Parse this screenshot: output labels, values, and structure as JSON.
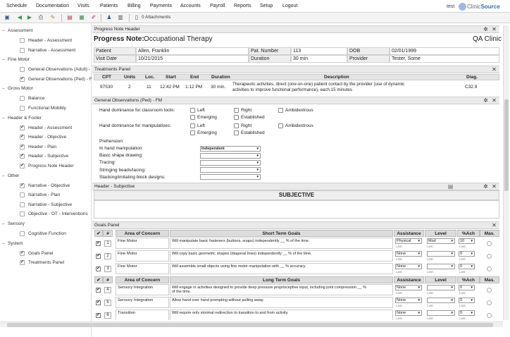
{
  "menu": [
    "Schedule",
    "Documentation",
    "Visits",
    "Patients",
    "Billing",
    "Payments",
    "Accounts",
    "Payroll",
    "Reports",
    "Setup",
    "Logout"
  ],
  "user": "test",
  "logo": {
    "part1": "Clinic",
    "part2": "Source"
  },
  "toolbar": {
    "attachments": "0 Attachments"
  },
  "sidebar": {
    "groups": [
      {
        "label": "Assessment",
        "items": [
          {
            "label": "Header - Assessment",
            "checked": false
          },
          {
            "label": "Narrative - Assessment",
            "checked": false
          }
        ]
      },
      {
        "label": "Fine Motor",
        "items": [
          {
            "label": "General Observations (Adult) -",
            "checked": false
          },
          {
            "label": "General Observations (Ped) - F",
            "checked": true
          }
        ]
      },
      {
        "label": "Gross Motor",
        "items": [
          {
            "label": "Balance",
            "checked": false
          },
          {
            "label": "Functional Mobility",
            "checked": false
          }
        ]
      },
      {
        "label": "Header & Footer",
        "items": [
          {
            "label": "Header - Assessment",
            "checked": true
          },
          {
            "label": "Header - Objective",
            "checked": true
          },
          {
            "label": "Header - Plan",
            "checked": true
          },
          {
            "label": "Header - Subjective",
            "checked": true
          },
          {
            "label": "Progress Note Header",
            "checked": true
          }
        ]
      },
      {
        "label": "Other",
        "items": [
          {
            "label": "Narrative - Objective",
            "checked": true
          },
          {
            "label": "Narrative - Plan",
            "checked": false
          },
          {
            "label": "Narrative - Subjective",
            "checked": false
          },
          {
            "label": "Objective - OT - Interventions",
            "checked": false
          }
        ]
      },
      {
        "label": "Sensory",
        "items": [
          {
            "label": "Cognitive Function",
            "checked": false
          }
        ]
      },
      {
        "label": "System",
        "items": [
          {
            "label": "Goals Panel",
            "checked": true
          },
          {
            "label": "Treatments Panel",
            "checked": true
          }
        ]
      }
    ]
  },
  "progress_header": {
    "panel_title": "Progress Note Header",
    "title_label": "Progress Note:",
    "title_value": "Occupational Therapy",
    "clinic": "QA Clinic",
    "patient_label": "Patient",
    "patient": "Allen, Franklin",
    "patnum_label": "Pat. Number",
    "patnum": "113",
    "dob_label": "DOB",
    "dob": "02/01/1999",
    "visitdate_label": "Visit Date",
    "visitdate": "10/21/2015",
    "duration_label": "Duration",
    "duration": "30 min",
    "provider_label": "Provider",
    "provider": "Tester, Some"
  },
  "treatments": {
    "panel_title": "Treatments Panel",
    "headers": [
      "CPT",
      "Units",
      "Loc.",
      "Start",
      "End",
      "Duration",
      "Description",
      "Diag."
    ],
    "row": {
      "cpt": "97530",
      "units": "2",
      "loc": "11",
      "start": "12:42 PM",
      "end": "1:12 PM",
      "duration": "30 min.",
      "desc1": "Therapeutic activities, direct (one-on-one) patient contact by the provider (use of dynamic",
      "desc2": "activities to improve functional performance), each 15 minutes",
      "diag": "C32.9"
    }
  },
  "observations": {
    "panel_title": "General Observations (Ped) - FM",
    "classroom_label": "Hand dominance for classroom tools:",
    "manip_label": "Hand dominance for manipulatives:",
    "opt_left": "Left",
    "opt_right": "Right",
    "opt_ambi": "Ambidextrous",
    "opt_emerging": "Emerging",
    "opt_established": "Established",
    "prehension_label": "Prehension:",
    "rows": [
      {
        "label": "In hand manipulation:",
        "value": "Independent"
      },
      {
        "label": "Basic shape drawing:",
        "value": ""
      },
      {
        "label": "Tracing:",
        "value": ""
      },
      {
        "label": "Stringing beads/lacing:",
        "value": ""
      },
      {
        "label": "Stacking/imitating block designs:",
        "value": ""
      }
    ]
  },
  "subjective": {
    "panel_title": "Header - Subjective",
    "heading": "SUBJECTIVE"
  },
  "goals": {
    "panel_title": "Goals Panel",
    "h_num": "#",
    "h_area": "Area of Concern",
    "h_stg": "Short Term Goals",
    "h_ltg": "Long Term Goals",
    "h_assist": "Assistance",
    "h_level": "Level",
    "h_ach": "%Ach",
    "h_mas": "Mas.",
    "last_label": "Last:",
    "short": [
      {
        "num": "1",
        "area": "Fine Motor",
        "goal": "Will manipulate basic fasteners (buttons, snaps) independently __ % of the time.",
        "assist": "Physical",
        "level": "Mod",
        "ach": "10"
      },
      {
        "num": "2",
        "area": "Fine Motor",
        "goal": "Will copy basic geometric shapes (diagonal lines) independently __ % of the time.",
        "assist": "None",
        "level": "",
        "ach": "0"
      },
      {
        "num": "3",
        "area": "Fine Motor",
        "goal": "Will assemble small objects using fine motor manipulation with __ % accuracy.",
        "assist": "None",
        "level": "",
        "ach": "0"
      }
    ],
    "long": [
      {
        "num": "4",
        "area": "Sensory Integration",
        "goal1": "Will engage in activities designed to provide deep pressure proprioceptive  input, including joint compression __ %",
        "goal2": "of the time.",
        "assist": "None",
        "level": "",
        "ach": "0"
      },
      {
        "num": "5",
        "area": "Sensory Integration",
        "goal1": "Allow hand over hand prompting without pulling away.",
        "goal2": "",
        "assist": "None",
        "level": "",
        "ach": "0"
      },
      {
        "num": "6",
        "area": "Transition",
        "goal1": "Will require only minimal redirection to transition to and from activity.",
        "goal2": "",
        "assist": "None",
        "level": "",
        "ach": "0"
      }
    ]
  }
}
